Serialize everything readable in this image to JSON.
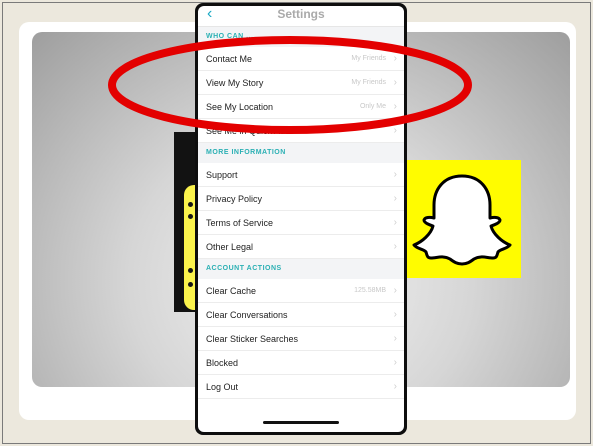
{
  "settings": {
    "title": "Settings",
    "sections": [
      {
        "header": "WHO CAN ...",
        "rows": [
          {
            "label": "Contact Me",
            "value": "My Friends"
          },
          {
            "label": "View My Story",
            "value": "My Friends"
          },
          {
            "label": "See My Location",
            "value": "Only Me"
          },
          {
            "label": "See Me in Quick Add",
            "value": ""
          }
        ]
      },
      {
        "header": "MORE INFORMATION",
        "rows": [
          {
            "label": "Support",
            "value": ""
          },
          {
            "label": "Privacy Policy",
            "value": ""
          },
          {
            "label": "Terms of Service",
            "value": ""
          },
          {
            "label": "Other Legal",
            "value": ""
          }
        ]
      },
      {
        "header": "ACCOUNT ACTIONS",
        "rows": [
          {
            "label": "Clear Cache",
            "value": "125.58MB"
          },
          {
            "label": "Clear Conversations",
            "value": ""
          },
          {
            "label": "Clear Sticker Searches",
            "value": ""
          },
          {
            "label": "Blocked",
            "value": ""
          },
          {
            "label": "Log Out",
            "value": ""
          }
        ]
      }
    ]
  },
  "colors": {
    "accent": "#2bb0b4",
    "highlight": "#e30000",
    "snapchat_yellow": "#fffc00"
  },
  "icons": {
    "back": "chevron-left-icon",
    "row_arrow": "chevron-right-icon",
    "logo": "snapchat-ghost-icon"
  }
}
